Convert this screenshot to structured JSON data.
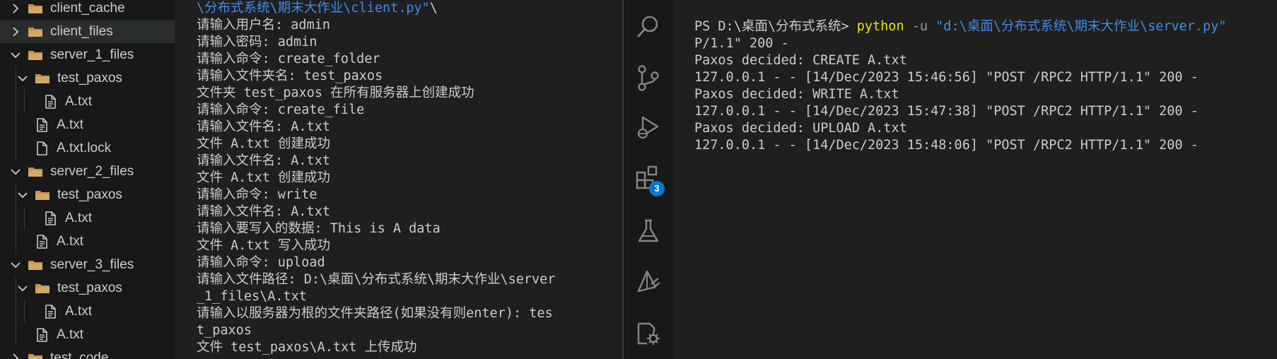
{
  "explorer": {
    "items": [
      {
        "label": "client_cache",
        "type": "folder",
        "expanded": false,
        "depth": 1
      },
      {
        "label": "client_files",
        "type": "folder",
        "expanded": false,
        "depth": 1
      },
      {
        "label": "server_1_files",
        "type": "folder",
        "expanded": true,
        "depth": 1
      },
      {
        "label": "test_paxos",
        "type": "folder",
        "expanded": true,
        "depth": 2
      },
      {
        "label": "A.txt",
        "type": "file",
        "depth": 3
      },
      {
        "label": "A.txt",
        "type": "file",
        "depth": 2
      },
      {
        "label": "A.txt.lock",
        "type": "file-blank",
        "depth": 2
      },
      {
        "label": "server_2_files",
        "type": "folder",
        "expanded": true,
        "depth": 1
      },
      {
        "label": "test_paxos",
        "type": "folder",
        "expanded": true,
        "depth": 2
      },
      {
        "label": "A.txt",
        "type": "file",
        "depth": 3
      },
      {
        "label": "A.txt",
        "type": "file",
        "depth": 2
      },
      {
        "label": "server_3_files",
        "type": "folder",
        "expanded": true,
        "depth": 1
      },
      {
        "label": "test_paxos",
        "type": "folder",
        "expanded": true,
        "depth": 2
      },
      {
        "label": "A.txt",
        "type": "file",
        "depth": 3
      },
      {
        "label": "A.txt",
        "type": "file",
        "depth": 2
      },
      {
        "label": "test_code",
        "type": "folder",
        "expanded": false,
        "depth": 1
      }
    ]
  },
  "client_terminal": {
    "first_line_path": "\\分布式系统\\期末大作业\\client.py\"",
    "first_line_tail": "\\",
    "lines": [
      "请输入用户名: admin",
      "请输入密码: admin",
      "请输入命令: create_folder",
      "请输入文件夹名: test_paxos",
      "文件夹 test_paxos 在所有服务器上创建成功",
      "请输入命令: create_file",
      "请输入文件名: A.txt",
      "文件 A.txt 创建成功",
      "请输入文件名: A.txt",
      "文件 A.txt 创建成功",
      "请输入命令: write",
      "请输入文件名: A.txt",
      "请输入要写入的数据: This is A data",
      "文件 A.txt 写入成功",
      "请输入命令: upload",
      "请输入文件路径: D:\\桌面\\分布式系统\\期末大作业\\server",
      "_1_files\\A.txt",
      "请输入以服务器为根的文件夹路径(如果没有则enter): tes",
      "t_paxos",
      "文件 test_paxos\\A.txt 上传成功"
    ]
  },
  "activity_bar": {
    "items": [
      "search-icon",
      "source-control-icon",
      "run-debug-icon",
      "extensions-icon",
      "testing-icon",
      "remote-icon",
      "settings-sync-icon"
    ],
    "extensions_badge": "3"
  },
  "server_terminal": {
    "prompt": "PS D:\\桌面\\分布式系统> ",
    "command": "python",
    "flag": " -u ",
    "arg": "\"d:\\桌面\\分布式系统\\期末大作业\\server.py\"",
    "lines": [
      "P/1.1\" 200 -",
      "Paxos decided: CREATE A.txt",
      "127.0.0.1 - - [14/Dec/2023 15:46:56] \"POST /RPC2 HTTP/1.1\" 200 -",
      "Paxos decided: WRITE A.txt",
      "127.0.0.1 - - [14/Dec/2023 15:47:38] \"POST /RPC2 HTTP/1.1\" 200 -",
      "Paxos decided: UPLOAD A.txt",
      "127.0.0.1 - - [14/Dec/2023 15:48:06] \"POST /RPC2 HTTP/1.1\" 200 -"
    ]
  },
  "colors": {
    "accent": "#0078d4",
    "path_blue": "#3b8eea",
    "command_yellow": "#e5e510",
    "folder_brown": "#c09553"
  }
}
